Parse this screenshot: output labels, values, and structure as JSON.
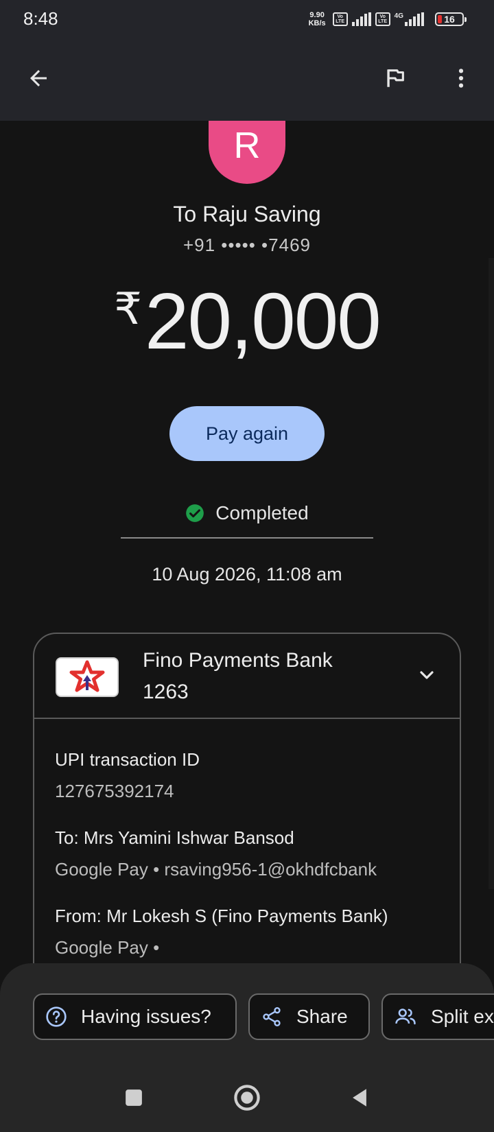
{
  "status_bar": {
    "time": "8:48",
    "net_speed_value": "9.90",
    "net_speed_unit": "KB/s",
    "volte_top": "Vo",
    "volte_bottom": "LTE",
    "network_type": "4G",
    "battery_level": "16",
    "battery_color": "#e2302e"
  },
  "app_bar": {
    "back_icon": "arrow-back-icon",
    "report_icon": "flag-icon",
    "more_icon": "more-vert-icon"
  },
  "transaction": {
    "avatar_initial": "R",
    "avatar_color": "#e94b86",
    "payee_title": "To Raju Saving",
    "payee_phone": "+91 ••••• •7469",
    "currency_symbol": "₹",
    "amount": "20,000",
    "pay_again_label": "Pay again",
    "status": "Completed",
    "status_color": "#1e9e4a",
    "datetime": "10 Aug 2026, 11:08 am"
  },
  "details": {
    "bank_name": "Fino Payments Bank",
    "bank_account": "1263",
    "upi_label": "UPI transaction ID",
    "upi_id": "127675392174",
    "to_label": "To: Mrs Yamini Ishwar Bansod",
    "to_value": "Google Pay • rsaving956-1@okhdfcbank",
    "from_label": "From: Mr Lokesh  S (Fino Payments Bank)",
    "from_value": "Google Pay •"
  },
  "actions": {
    "issues_label": "Having issues?",
    "share_label": "Share",
    "split_label": "Split ex"
  },
  "accent_color": "#a9c7fb"
}
